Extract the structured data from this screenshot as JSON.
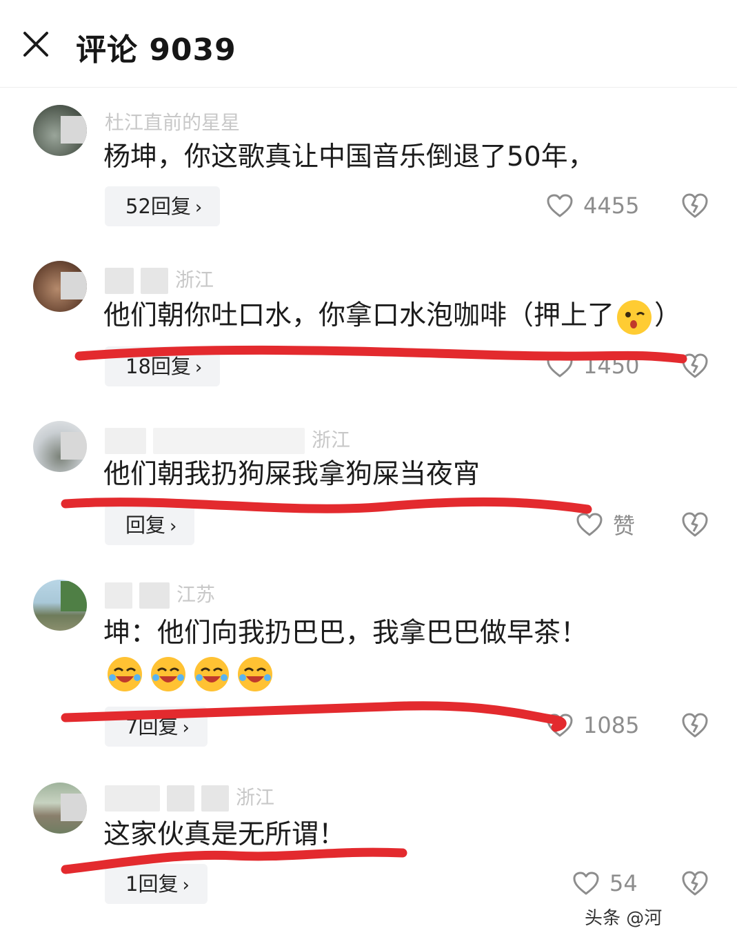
{
  "header": {
    "title": "评论 9039"
  },
  "comments": [
    {
      "meta": "杜江直前的星星",
      "text": "杨坤，你这歌真让中国音乐倒退了50年，",
      "reply_label": "52回复",
      "like_count": "4455"
    },
    {
      "meta": "浙江",
      "text": "他们朝你吐口水，你拿口水泡咖啡（押上了",
      "text_end": "）",
      "emoji": "winking-face-emoji",
      "reply_label": "18回复",
      "like_count": "1450"
    },
    {
      "meta": "浙江",
      "text": "他们朝我扔狗屎我拿狗屎当夜宵",
      "reply_label": "回复",
      "like_count": "赞"
    },
    {
      "meta": "江苏",
      "text": "坤：他们向我扔巴巴，我拿巴巴做早茶！",
      "emoji": "laughing-crying-emoji",
      "emoji_count": 4,
      "reply_label": "7回复",
      "like_count": "1085"
    },
    {
      "meta": "浙江",
      "text": "这家伙真是无所谓！",
      "reply_label": "1回复",
      "like_count": "54"
    }
  ],
  "watermark": "头条 @河",
  "colors": {
    "annotation_red": "#e32a2e",
    "reply_bg": "#f2f3f5",
    "muted_text": "#8d8d8d"
  },
  "icons": {
    "close": "close-icon",
    "like": "heart-icon",
    "dislike": "broken-heart-icon",
    "reply_arrow": "chevron-right-icon"
  }
}
